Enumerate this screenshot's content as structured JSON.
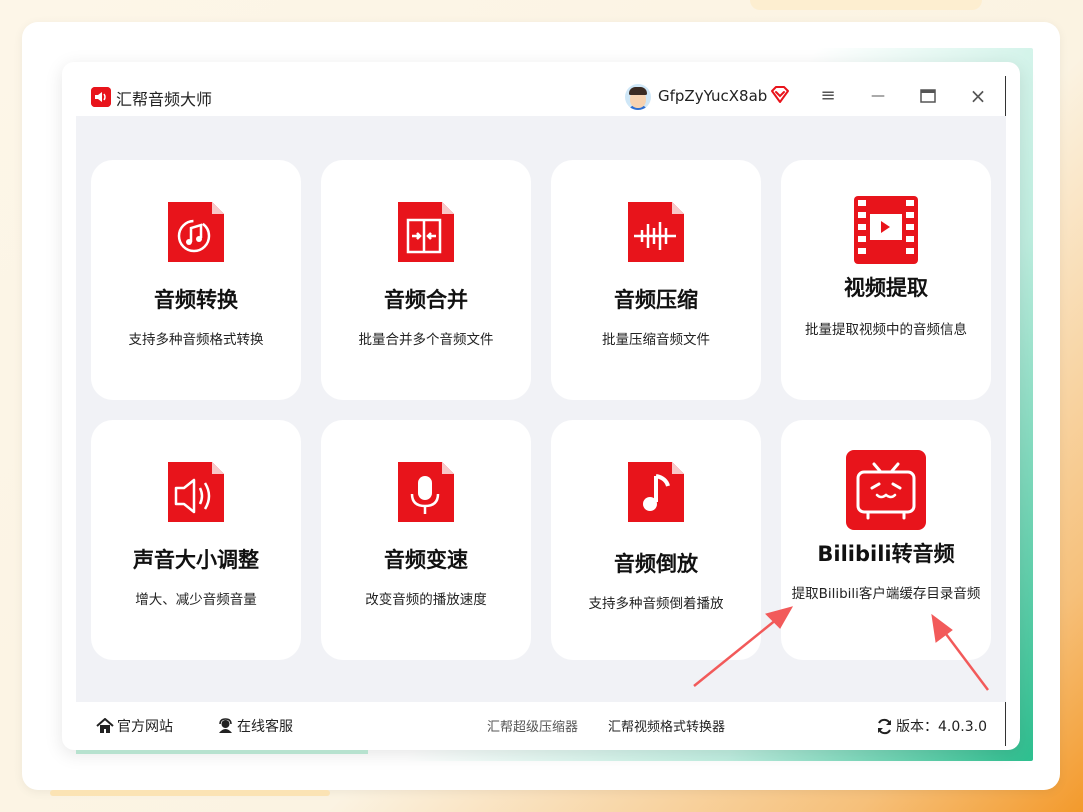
{
  "app": {
    "title": "汇帮音频大师",
    "username": "GfpZyYucX8ab"
  },
  "window_controls": {
    "menu": "≡",
    "minimize": "—",
    "maximize": "▭",
    "close": "×"
  },
  "cards": [
    {
      "title": "音频转换",
      "desc": "支持多种音频格式转换",
      "icon": "audio-convert-icon"
    },
    {
      "title": "音频合并",
      "desc": "批量合并多个音频文件",
      "icon": "audio-merge-icon"
    },
    {
      "title": "音频压缩",
      "desc": "批量压缩音频文件",
      "icon": "audio-compress-icon"
    },
    {
      "title": "视频提取",
      "desc": "批量提取视频中的音频信息",
      "icon": "video-extract-icon"
    },
    {
      "title": "声音大小调整",
      "desc": "增大、减少音频音量",
      "icon": "volume-adjust-icon"
    },
    {
      "title": "音频变速",
      "desc": "改变音频的播放速度",
      "icon": "microphone-icon"
    },
    {
      "title": "音频倒放",
      "desc": "支持多种音频倒着播放",
      "icon": "music-note-icon"
    },
    {
      "title": "Bilibili转音频",
      "desc": "提取Bilibili客户端缓存目录音频",
      "icon": "bilibili-tv-icon"
    }
  ],
  "footer": {
    "website": "官方网站",
    "support": "在线客服",
    "link1": "汇帮超级压缩器",
    "link2": "汇帮视频格式转换器",
    "version": "版本：4.0.3.0"
  },
  "colors": {
    "brand_red": "#e8141b",
    "annotation_arrow": "#f25a5a"
  }
}
